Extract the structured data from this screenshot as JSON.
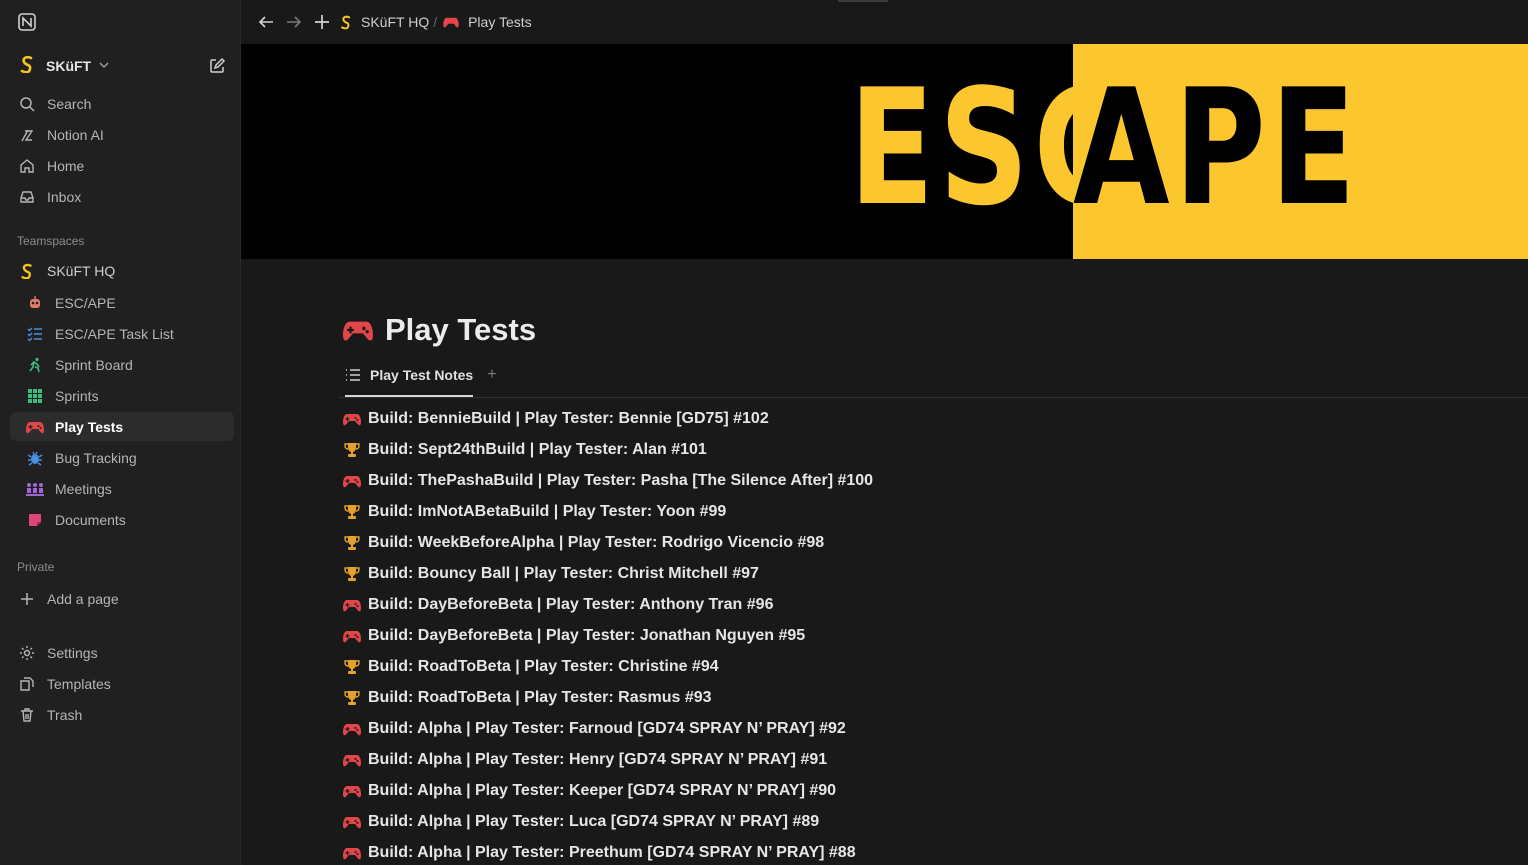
{
  "sidebar": {
    "workspace": "SKüFT",
    "nav": [
      {
        "label": "Search",
        "icon": "search-icon"
      },
      {
        "label": "Notion AI",
        "icon": "notion-ai-icon"
      },
      {
        "label": "Home",
        "icon": "home-icon"
      },
      {
        "label": "Inbox",
        "icon": "inbox-icon"
      }
    ],
    "teamspaces_label": "Teamspaces",
    "teamspace": "SKüFT HQ",
    "pages": [
      {
        "label": "ESC/APE",
        "icon": "robot-icon"
      },
      {
        "label": "ESC/APE Task List",
        "icon": "checklist-icon"
      },
      {
        "label": "Sprint Board",
        "icon": "runner-icon"
      },
      {
        "label": "Sprints",
        "icon": "grid-icon"
      },
      {
        "label": "Play Tests",
        "icon": "gamepad-icon"
      },
      {
        "label": "Bug Tracking",
        "icon": "bug-icon"
      },
      {
        "label": "Meetings",
        "icon": "people-icon"
      },
      {
        "label": "Documents",
        "icon": "note-icon"
      }
    ],
    "private_label": "Private",
    "add_page": "Add a page",
    "footer": [
      {
        "label": "Settings",
        "icon": "gear-icon"
      },
      {
        "label": "Templates",
        "icon": "templates-icon"
      },
      {
        "label": "Trash",
        "icon": "trash-icon"
      }
    ]
  },
  "topbar": {
    "crumbs": [
      "SKüFT HQ",
      "Play Tests"
    ],
    "separator": "/"
  },
  "cover": {
    "left": "ESC",
    "right": "APE",
    "colors": {
      "yellow": "#fcc72e",
      "black": "#000000"
    }
  },
  "page": {
    "title": "Play Tests",
    "view_tab": "Play Test Notes",
    "items": [
      {
        "text": "Build: BennieBuild | Play Tester: Bennie [GD75] #102",
        "icon": "gamepad-icon"
      },
      {
        "text": "Build: Sept24thBuild | Play Tester: Alan #101",
        "icon": "trophy-icon"
      },
      {
        "text": "Build: ThePashaBuild | Play Tester: Pasha [The Silence After] #100",
        "icon": "gamepad-icon"
      },
      {
        "text": "Build: ImNotABetaBuild | Play Tester: Yoon #99",
        "icon": "trophy-icon"
      },
      {
        "text": "Build: WeekBeforeAlpha | Play Tester: Rodrigo Vicencio #98",
        "icon": "trophy-icon"
      },
      {
        "text": "Build: Bouncy Ball | Play Tester: Christ Mitchell #97",
        "icon": "trophy-icon"
      },
      {
        "text": "Build: DayBeforeBeta | Play Tester: Anthony Tran #96",
        "icon": "gamepad-icon"
      },
      {
        "text": "Build: DayBeforeBeta | Play Tester: Jonathan Nguyen #95",
        "icon": "gamepad-icon"
      },
      {
        "text": "Build: RoadToBeta | Play Tester: Christine #94",
        "icon": "trophy-icon"
      },
      {
        "text": "Build: RoadToBeta | Play Tester: Rasmus #93",
        "icon": "trophy-icon"
      },
      {
        "text": "Build: Alpha | Play Tester: Farnoud [GD74 SPRAY N’ PRAY] #92",
        "icon": "gamepad-icon"
      },
      {
        "text": "Build: Alpha | Play Tester: Henry [GD74 SPRAY N’ PRAY] #91",
        "icon": "gamepad-icon"
      },
      {
        "text": "Build: Alpha | Play Tester: Keeper [GD74 SPRAY N’ PRAY] #90",
        "icon": "gamepad-icon"
      },
      {
        "text": "Build: Alpha | Play Tester: Luca [GD74 SPRAY N’ PRAY] #89",
        "icon": "gamepad-icon"
      },
      {
        "text": "Build: Alpha | Play Tester: Preethum [GD74 SPRAY N’ PRAY] #88",
        "icon": "gamepad-icon"
      }
    ]
  },
  "colors": {
    "accent_red": "#e0464a",
    "accent_gold": "#e3a32a",
    "yellow": "#f5c518"
  }
}
